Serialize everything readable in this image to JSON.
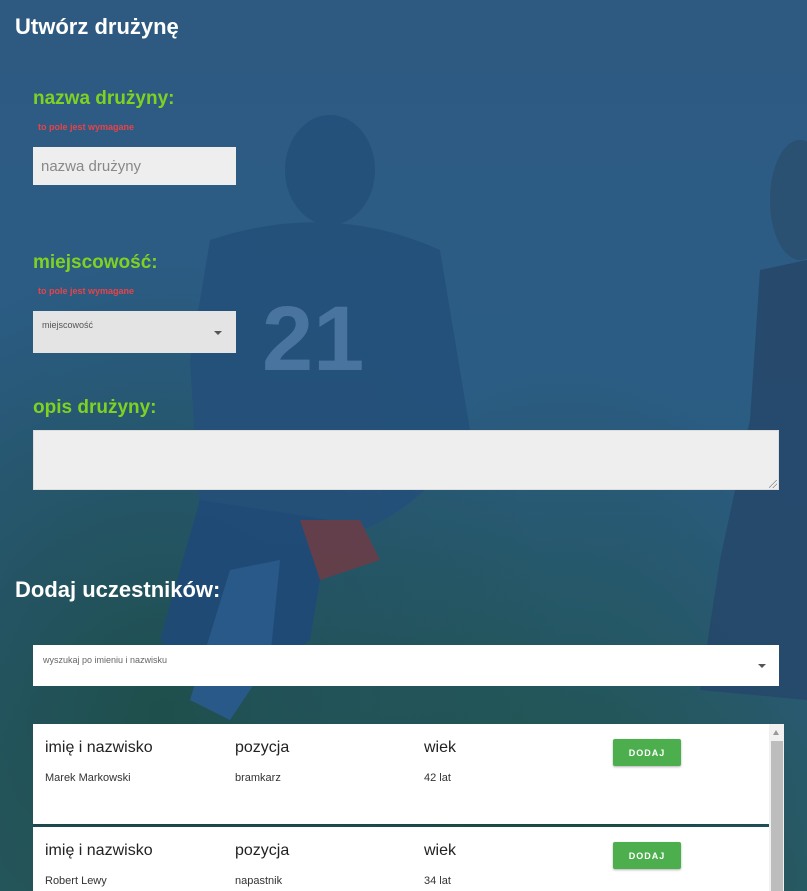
{
  "page_title": "Utwórz drużynę",
  "form": {
    "team_name": {
      "label": "nazwa drużyny:",
      "error": "to pole jest wymagane",
      "placeholder": "nazwa drużyny"
    },
    "city": {
      "label": "miejscowość:",
      "error": "to pole jest wymagane",
      "select_label": "miejscowość"
    },
    "description": {
      "label": "opis drużyny:",
      "value": ""
    }
  },
  "participants": {
    "title": "Dodaj uczestników:",
    "search_label": "wyszukaj po imieniu i nazwisku",
    "columns": [
      "imię i nazwisko",
      "pozycja",
      "wiek"
    ],
    "add_label": "DODAJ",
    "rows": [
      {
        "name": "Marek Markowski",
        "position": "bramkarz",
        "age": "42 lat"
      },
      {
        "name": "Robert Lewy",
        "position": "napastnik",
        "age": "34 lat"
      }
    ]
  },
  "colors": {
    "accent_green": "#7ed321",
    "error_red": "#e8434a",
    "button_green": "#4cae4c"
  }
}
